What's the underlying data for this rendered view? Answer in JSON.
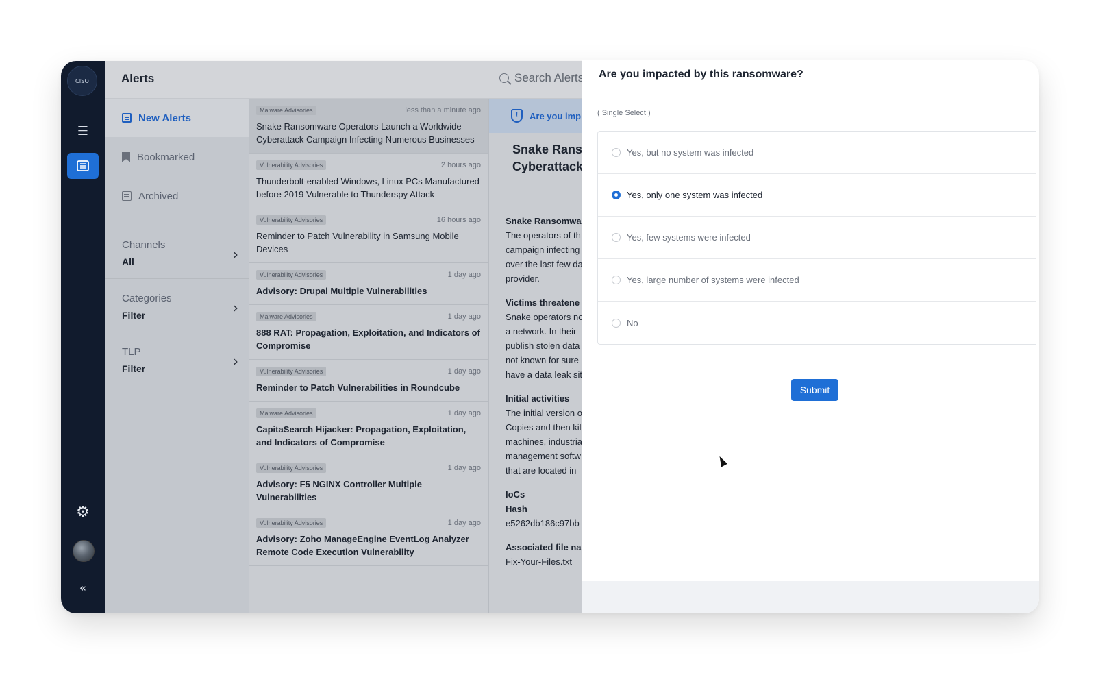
{
  "rail": {
    "logo": "CISO",
    "icons": [
      "menu-icon",
      "alerts-icon",
      "gear-icon",
      "avatar",
      "collapse-icon"
    ],
    "accent_color": "#1f6fd6"
  },
  "header": {
    "title": "Alerts",
    "search_placeholder": "Search Alerts"
  },
  "nav": {
    "items": [
      {
        "label": "New Alerts",
        "active": true
      },
      {
        "label": "Bookmarked"
      },
      {
        "label": "Archived"
      }
    ],
    "filters": [
      {
        "label": "Channels",
        "value": "All"
      },
      {
        "label": "Categories",
        "value": "Filter"
      },
      {
        "label": "TLP",
        "value": "Filter"
      }
    ]
  },
  "alerts": [
    {
      "category": "Malware Advisories",
      "time": "less than a minute ago",
      "title": "Snake Ransomware Operators Launch a Worldwide Cyberattack Campaign Infecting Numerous Businesses"
    },
    {
      "category": "Vulnerability Advisories",
      "time": "2 hours ago",
      "title": "Thunderbolt-enabled Windows, Linux PCs Manufactured before 2019 Vulnerable to Thunderspy Attack"
    },
    {
      "category": "Vulnerability Advisories",
      "time": "16 hours ago",
      "title": "Reminder to Patch Vulnerability in Samsung Mobile Devices"
    },
    {
      "category": "Vulnerability Advisories",
      "time": "1 day ago",
      "title": "Advisory: Drupal Multiple Vulnerabilities"
    },
    {
      "category": "Malware Advisories",
      "time": "1 day ago",
      "title": "888 RAT: Propagation, Exploitation, and Indicators of Compromise"
    },
    {
      "category": "Vulnerability Advisories",
      "time": "1 day ago",
      "title": "Reminder to Patch Vulnerabilities in Roundcube"
    },
    {
      "category": "Malware Advisories",
      "time": "1 day ago",
      "title": "CapitaSearch Hijacker: Propagation, Exploitation, and Indicators of Compromise"
    },
    {
      "category": "Vulnerability Advisories",
      "time": "1 day ago",
      "title": "Advisory: F5 NGINX Controller Multiple Vulnerabilities"
    },
    {
      "category": "Vulnerability Advisories",
      "time": "1 day ago",
      "title": "Advisory: Zoho ManageEngine EventLog Analyzer Remote Code Execution Vulnerability"
    }
  ],
  "detail": {
    "banner": "Are you imp",
    "title_line1": "Snake Rans",
    "title_line2": "Cyberattack",
    "heading1": "Snake Ransomwa",
    "para1": [
      "The operators of th",
      "campaign infecting",
      "over the last few da",
      "provider."
    ],
    "heading2": "Victims threatene",
    "para2": [
      "Snake operators no",
      "a network. In their",
      "publish stolen data",
      "not known for sure",
      "have a data leak sit"
    ],
    "heading3": "Initial activities",
    "para3": [
      "The initial version o",
      "Copies and then kil",
      "machines, industria",
      "management softw",
      "that are located in"
    ],
    "heading4": "IoCs",
    "hash_label": "Hash",
    "hash_value": "e5262db186c97bb",
    "heading5": "Associated file na",
    "file_value": "Fix-Your-Files.txt"
  },
  "survey": {
    "question": "Are you impacted by this ransomware?",
    "hint": "( Single Select )",
    "options": [
      {
        "label": "Yes, but no system was infected",
        "selected": false
      },
      {
        "label": "Yes, only one system was infected",
        "selected": true
      },
      {
        "label": "Yes, few systems were infected",
        "selected": false
      },
      {
        "label": "Yes, large number of systems were infected",
        "selected": false
      },
      {
        "label": "No",
        "selected": false
      }
    ],
    "submit_label": "Submit"
  }
}
